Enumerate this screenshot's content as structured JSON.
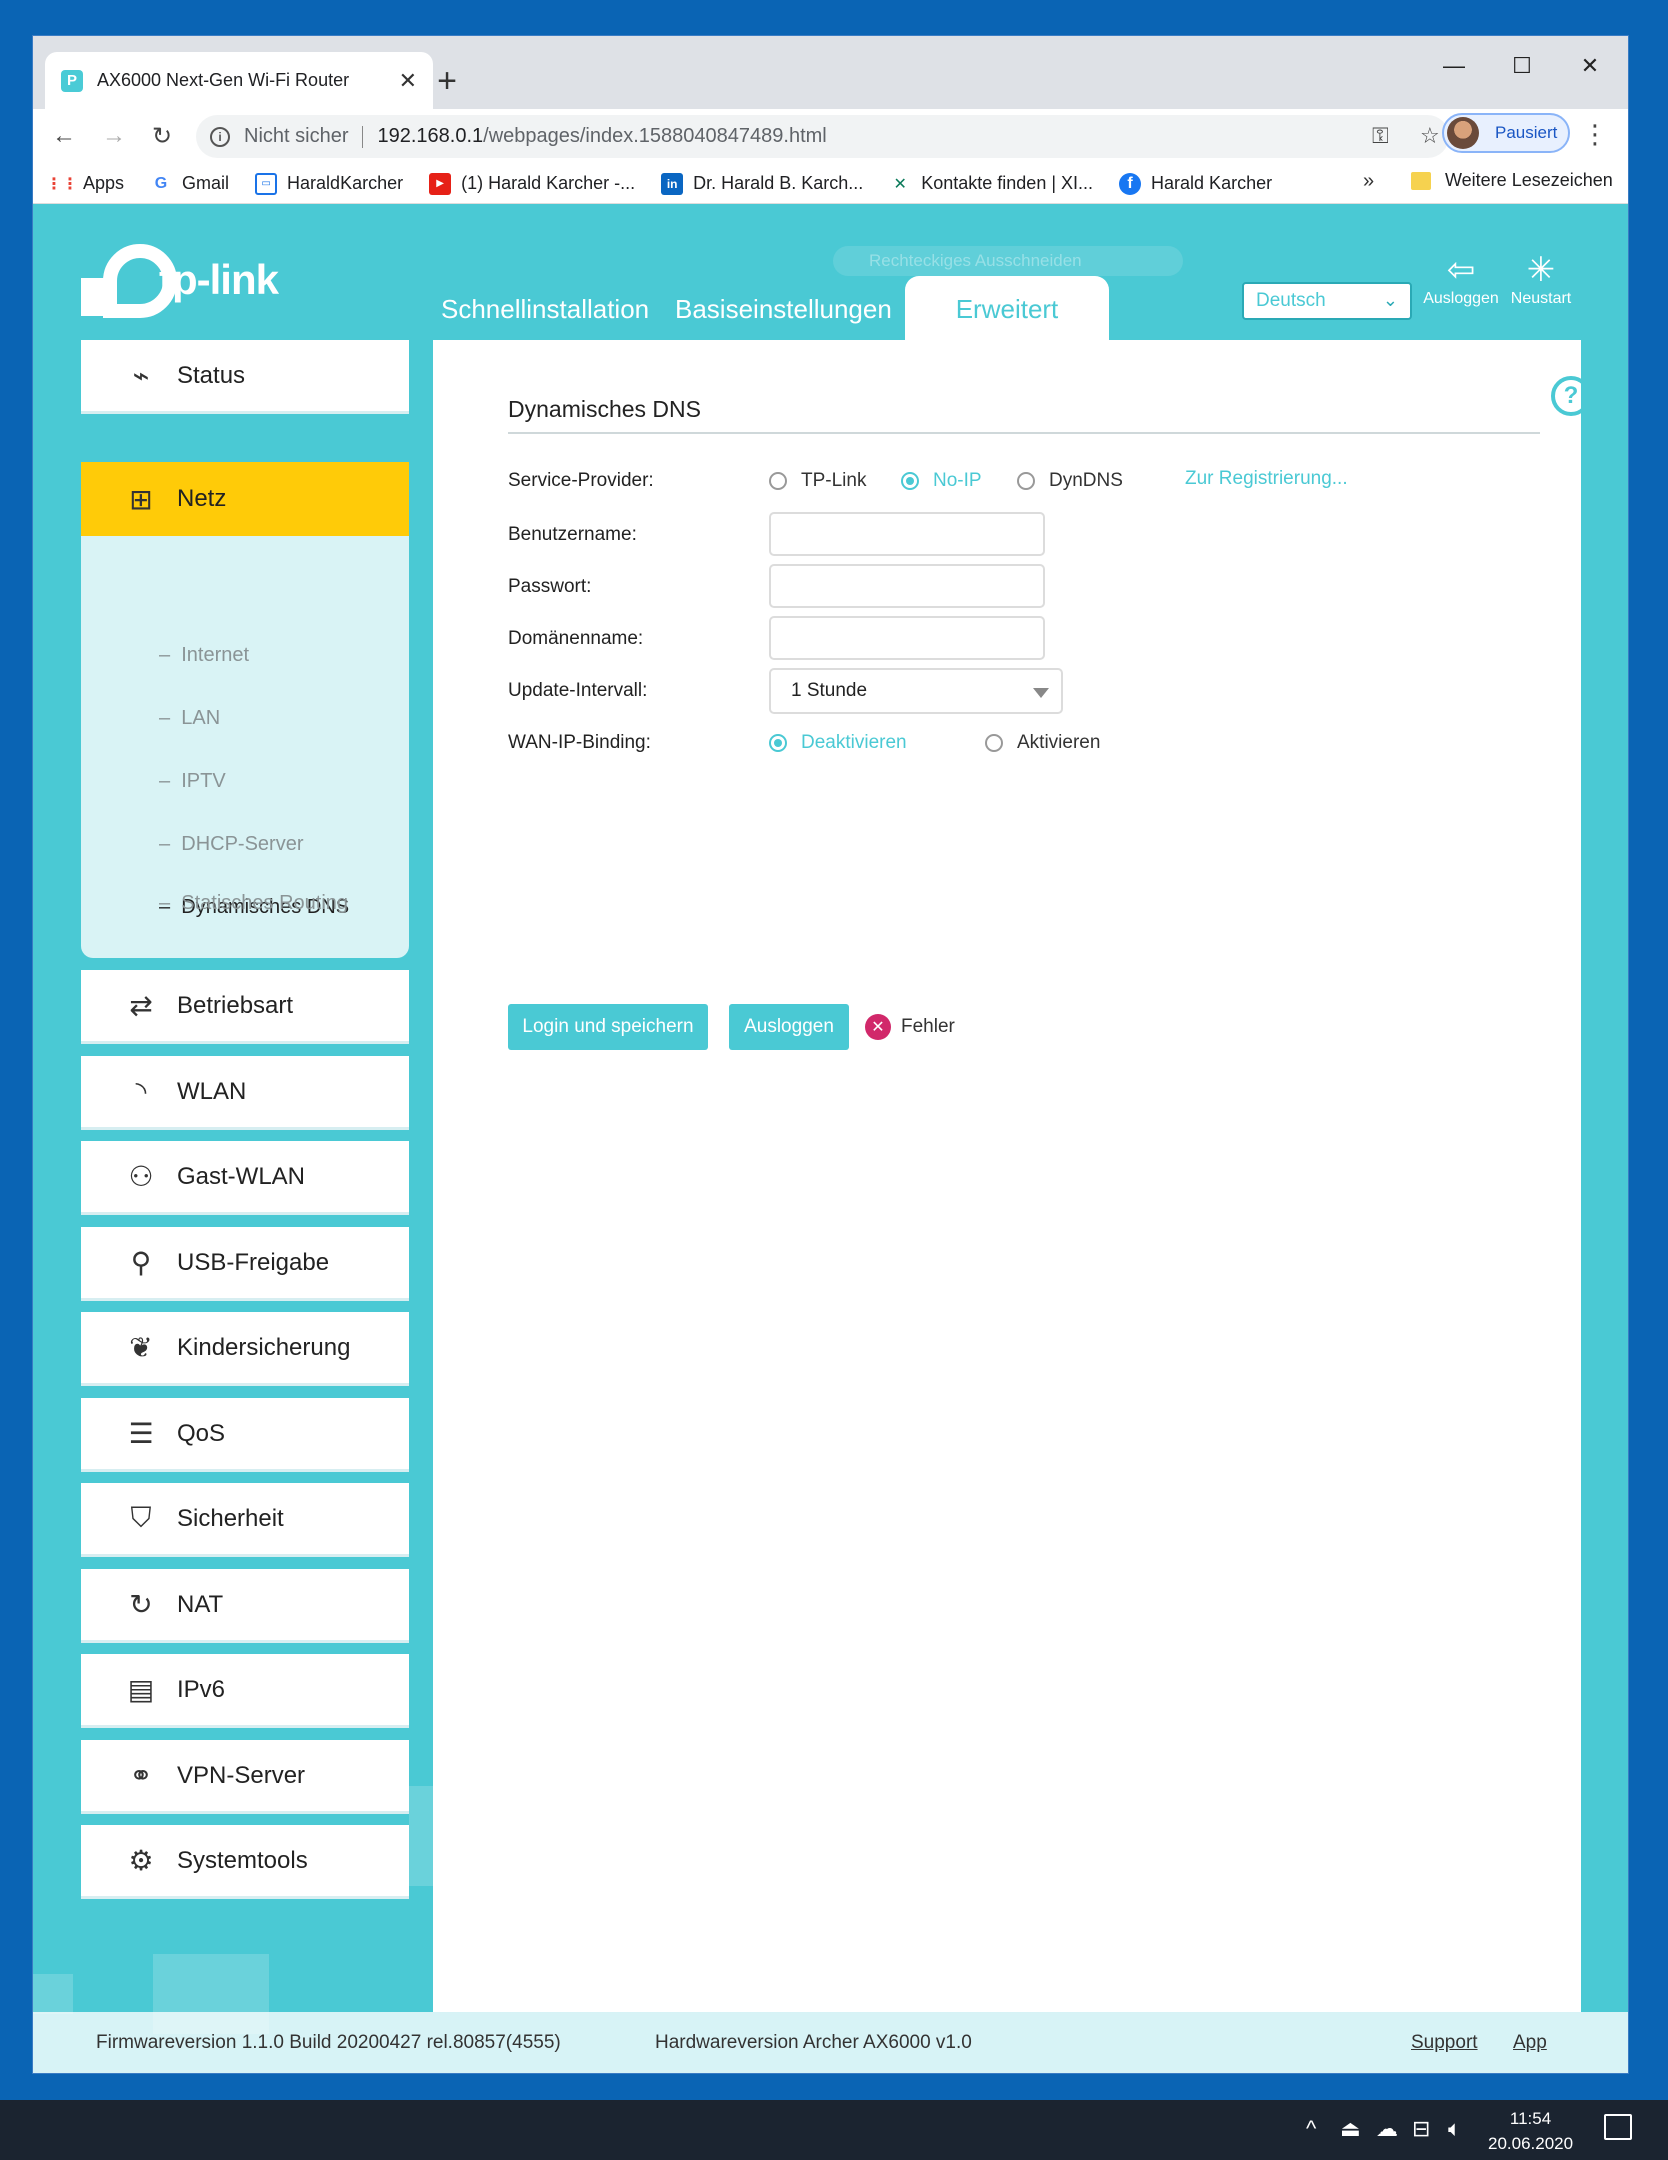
{
  "browser": {
    "tab_title": "AX6000 Next-Gen Wi-Fi Router",
    "tab_close": "✕",
    "new_tab": "+",
    "address": {
      "security": "Nicht sicher",
      "host": "192.168.0.1",
      "path": "/webpages/index.1588040847489.html"
    },
    "profile_label": "Pausiert",
    "bookmarks": [
      {
        "label": "Apps",
        "icon": "apps-grid-icon"
      },
      {
        "label": "Gmail",
        "icon": "google-icon"
      },
      {
        "label": "HaraldKarcher",
        "icon": "page-icon"
      },
      {
        "label": "(1) Harald Karcher -...",
        "icon": "youtube-icon"
      },
      {
        "label": "Dr. Harald B. Karch...",
        "icon": "linkedin-icon"
      },
      {
        "label": "Kontakte finden | XI...",
        "icon": "xing-icon"
      },
      {
        "label": "Harald Karcher",
        "icon": "facebook-icon"
      }
    ],
    "bookmarks_more": "»",
    "bookmarks_folder": "Weitere Lesezeichen"
  },
  "router": {
    "logo_text": "tp-link",
    "ghost_overlay": "Rechteckiges Ausschneiden",
    "nav": {
      "quick": "Schnellinstallation",
      "basic": "Basiseinstellungen",
      "advanced": "Erweitert"
    },
    "language": "Deutsch",
    "logout_label": "Ausloggen",
    "restart_label": "Neustart",
    "sidebar": {
      "status": "Status",
      "netz": "Netz",
      "sub": {
        "internet": "Internet",
        "lan": "LAN",
        "iptv": "IPTV",
        "dhcp": "DHCP-Server",
        "ddns": "Dynamisches DNS",
        "routing": "Statisches Routing"
      },
      "betriebsart": "Betriebsart",
      "wlan": "WLAN",
      "gastwlan": "Gast-WLAN",
      "usb": "USB-Freigabe",
      "kinder": "Kindersicherung",
      "qos": "QoS",
      "sicherheit": "Sicherheit",
      "nat": "NAT",
      "ipv6": "IPv6",
      "vpn": "VPN-Server",
      "system": "Systemtools"
    },
    "ddns": {
      "title": "Dynamisches DNS",
      "help": "?",
      "provider_label": "Service-Provider:",
      "providers": [
        "TP-Link",
        "No-IP",
        "DynDNS"
      ],
      "selected_provider": "No-IP",
      "register_link": "Zur Registrierung...",
      "username_label": "Benutzername:",
      "username_value": "",
      "password_label": "Passwort:",
      "password_value": "",
      "domain_label": "Domänenname:",
      "domain_value": "",
      "interval_label": "Update-Intervall:",
      "interval_value": "1 Stunde",
      "binding_label": "WAN-IP-Binding:",
      "binding_options": [
        "Deaktivieren",
        "Aktivieren"
      ],
      "binding_selected": "Deaktivieren",
      "login_save_button": "Login und speichern",
      "logout_button": "Ausloggen",
      "status_text": "Fehler"
    },
    "footer": {
      "firmware": "Firmwareversion 1.1.0 Build 20200427 rel.80857(4555)",
      "hardware": "Hardwareversion Archer AX6000 v1.0",
      "support": "Support",
      "app": "App"
    }
  },
  "taskbar": {
    "time": "11:54",
    "date": "20.06.2020"
  },
  "colors": {
    "accent": "#4ac9d4",
    "active_menu": "#ffcb08",
    "error": "#d1286a"
  }
}
